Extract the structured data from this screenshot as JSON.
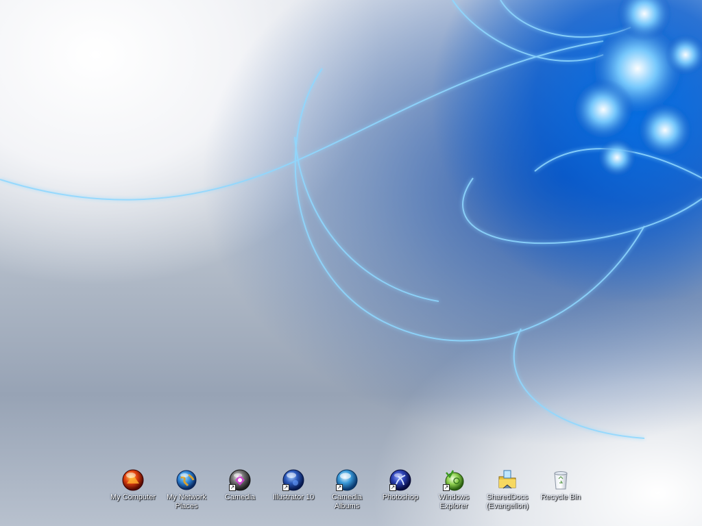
{
  "desktop": {
    "icons": [
      {
        "label": "My Computer",
        "icon": "my-computer-icon",
        "shortcut": false,
        "color": "#d43a10"
      },
      {
        "label": "My Network\nPlaces",
        "icon": "network-places-icon",
        "shortcut": false,
        "color": "#2b7fd0"
      },
      {
        "label": "Camedia",
        "icon": "camedia-icon",
        "shortcut": true,
        "color": "#c040c0"
      },
      {
        "label": "Illustrator 10",
        "icon": "illustrator-icon",
        "shortcut": true,
        "color": "#2a57b8"
      },
      {
        "label": "Camedia\nAlbums",
        "icon": "camedia-albums-icon",
        "shortcut": true,
        "color": "#3a9ad8"
      },
      {
        "label": "Photoshop",
        "icon": "photoshop-icon",
        "shortcut": true,
        "color": "#2a3fb0"
      },
      {
        "label": "Windows\nExplorer",
        "icon": "windows-explorer-icon",
        "shortcut": true,
        "color": "#6bbf30"
      },
      {
        "label": "SharedDocs\n(Evangelion)",
        "icon": "shared-docs-icon",
        "shortcut": false,
        "color": "#e0b030"
      },
      {
        "label": "Recycle Bin",
        "icon": "recycle-bin-icon",
        "shortcut": false,
        "color": "#c8ccd2"
      }
    ]
  }
}
